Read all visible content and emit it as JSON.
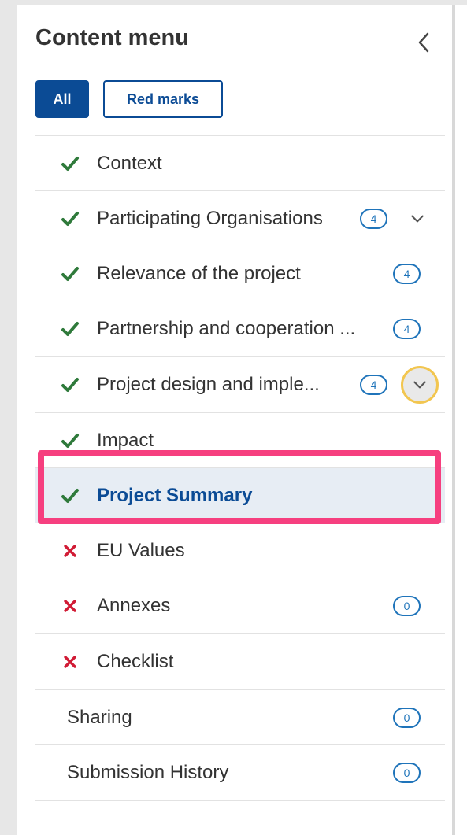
{
  "header": {
    "title": "Content menu",
    "collapse_icon": "chevron-left-icon"
  },
  "filters": [
    {
      "label": "All",
      "active": true
    },
    {
      "label": "Red marks",
      "active": false
    }
  ],
  "colors": {
    "brand": "#0b4b95",
    "complete": "#2f7a3b",
    "incomplete": "#d11b35",
    "badge": "#1f74ba",
    "highlight": "#f63f7f",
    "focus_ring": "#f2c650"
  },
  "menu": {
    "items": [
      {
        "label": "Context",
        "status": "complete"
      },
      {
        "label": "Participating Organisations",
        "status": "complete",
        "badge": "4",
        "expandable": true
      },
      {
        "label": "Relevance of the project",
        "status": "complete",
        "badge": "4"
      },
      {
        "label": "Partnership and cooperation ...",
        "status": "complete",
        "badge": "4"
      },
      {
        "label": "Project design and imple...",
        "status": "complete",
        "badge": "4",
        "expandable": true,
        "focused": true
      },
      {
        "label": "Impact",
        "status": "complete"
      },
      {
        "label": "Project Summary",
        "status": "complete",
        "selected": true
      },
      {
        "label": "EU Values",
        "status": "incomplete"
      },
      {
        "label": "Annexes",
        "status": "incomplete",
        "badge": "0"
      },
      {
        "label": "Checklist",
        "status": "incomplete"
      },
      {
        "label": "Sharing",
        "status": "none",
        "badge": "0"
      },
      {
        "label": "Submission History",
        "status": "none",
        "badge": "0"
      }
    ]
  }
}
